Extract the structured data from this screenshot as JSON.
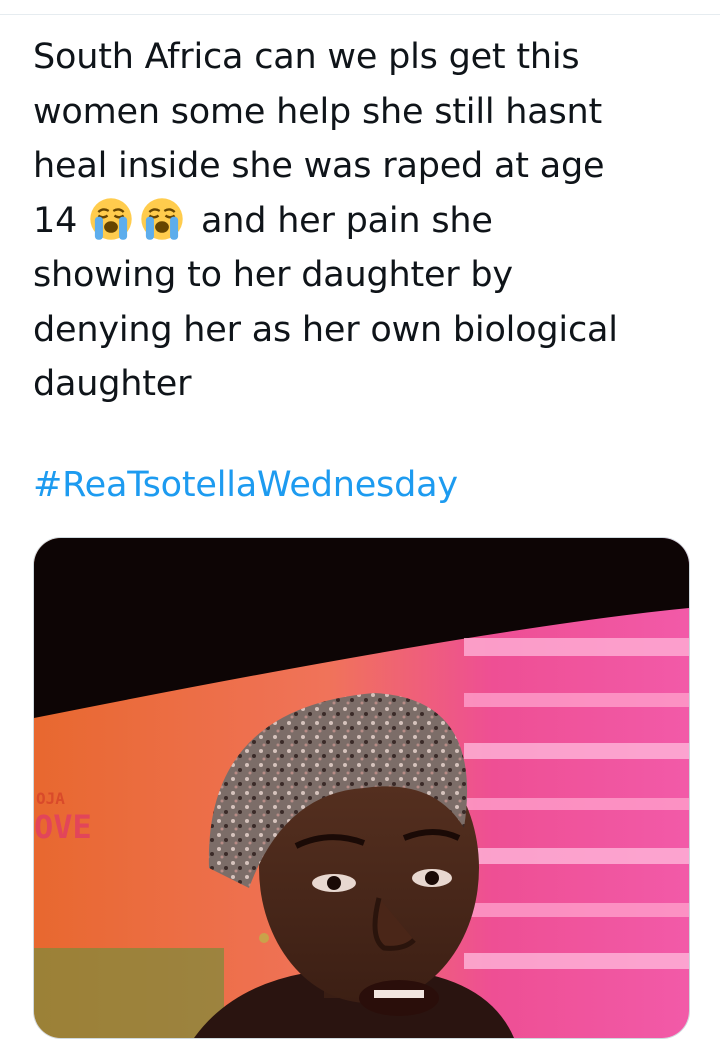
{
  "tweet": {
    "lines": [
      "South Africa can we pls get this",
      "women some help she still hasnt",
      "heal inside she was raped at age",
      "14",
      "and her pain she",
      "showing to her daughter by",
      "denying her as her own biological",
      "daughter"
    ],
    "emoji": [
      "loudly-crying-face-icon",
      "loudly-crying-face-icon"
    ],
    "hashtag": "#ReaTsotellaWednesday"
  },
  "media": {
    "watermark_line1": "OJA",
    "watermark_line2": "OVE"
  },
  "colors": {
    "text": "#0f1419",
    "link": "#1d9bf0",
    "divider": "#e6ecf0"
  }
}
